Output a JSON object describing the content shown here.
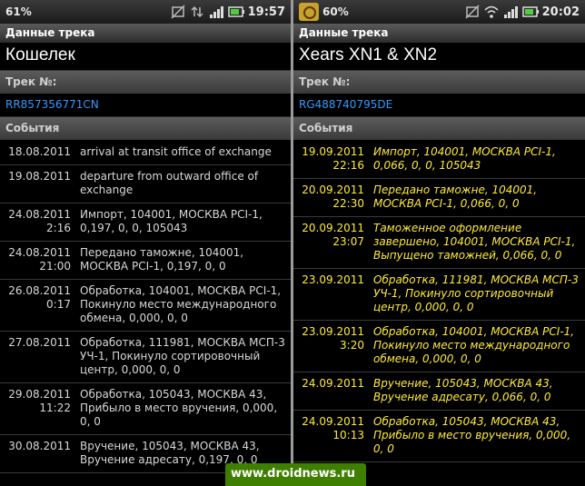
{
  "left": {
    "status": {
      "battery": "61%",
      "time": "19:57"
    },
    "title": "Данные трека",
    "name": "Кошелек",
    "track_label": "Трек №:",
    "track_number": "RR857356771CN",
    "events_label": "События",
    "events": [
      {
        "date": "18.08.2011",
        "desc": "arrival at transit office of exchange"
      },
      {
        "date": "19.08.2011",
        "desc": "departure from outward office of exchange"
      },
      {
        "date": "24.08.2011\n2:16",
        "desc": "Импорт, 104001, МОСКВА PCI-1, 0,197, 0, 0, 105043"
      },
      {
        "date": "24.08.2011\n21:00",
        "desc": "Передано таможне, 104001, МОСКВА PCI-1, 0,197, 0, 0"
      },
      {
        "date": "26.08.2011\n0:17",
        "desc": "Обработка, 104001, МОСКВА PCI-1, Покинуло место международного обмена, 0,000, 0, 0"
      },
      {
        "date": "27.08.2011",
        "desc": "Обработка, 111981, МОСКВА МСП-3 УЧ-1, Покинуло сортировочный центр, 0,000, 0, 0"
      },
      {
        "date": "29.08.2011\n11:22",
        "desc": "Обработка, 105043, МОСКВА 43, Прибыло в место вручения, 0,000, 0, 0"
      },
      {
        "date": "30.08.2011",
        "desc": "Вручение, 105043, МОСКВА 43, Вручение адресату, 0,197, 0, 0"
      }
    ]
  },
  "right": {
    "status": {
      "battery": "60%",
      "time": "20:02"
    },
    "title": "Данные трека",
    "name": "Xears XN1 & XN2",
    "track_label": "Трек №:",
    "track_number": "RG488740795DE",
    "events_label": "События",
    "events": [
      {
        "date": "19.09.2011\n22:16",
        "desc": "Импорт, 104001, МОСКВА PCI-1, 0,066, 0, 0, 105043"
      },
      {
        "date": "20.09.2011\n22:30",
        "desc": "Передано таможне, 104001, МОСКВА PCI-1, 0,066, 0, 0"
      },
      {
        "date": "20.09.2011\n23:07",
        "desc": "Таможенное оформление завершено, 104001, МОСКВА PCI-1, Выпущено таможней, 0,066, 0, 0"
      },
      {
        "date": "23.09.2011",
        "desc": "Обработка, 111981, МОСКВА МСП-3 УЧ-1, Покинуло сортировочный центр, 0,000, 0, 0"
      },
      {
        "date": "23.09.2011\n3:20",
        "desc": "Обработка, 104001, МОСКВА PCI-1, Покинуло место международного обмена, 0,000, 0, 0"
      },
      {
        "date": "24.09.2011",
        "desc": "Вручение, 105043, МОСКВА 43, Вручение адресату, 0,066, 0, 0"
      },
      {
        "date": "24.09.2011\n10:13",
        "desc": "Обработка, 105043, МОСКВА 43, Прибыло в место вручения, 0,000, 0, 0"
      }
    ]
  },
  "watermark": "www.droidnews.ru"
}
